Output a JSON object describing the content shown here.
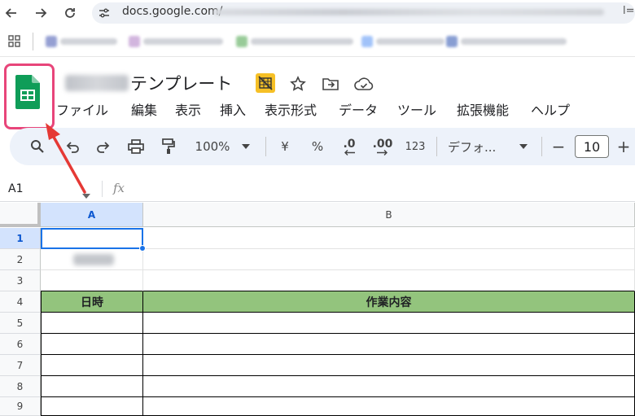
{
  "browser": {
    "url": "docs.google.com/",
    "url_tail": "l="
  },
  "doc": {
    "title": "テンプレート"
  },
  "menu": [
    "ファイル",
    "編集",
    "表示",
    "挿入",
    "表示形式",
    "データ",
    "ツール",
    "拡張機能",
    "ヘルプ"
  ],
  "toolbar": {
    "zoom": "100%",
    "currency": "¥",
    "percent": "%",
    "decrease_decimal": ".0",
    "increase_decimal": ".00",
    "number_format": "123",
    "font": "デフォ...",
    "font_size": "10",
    "minus": "−",
    "plus": "+"
  },
  "formula_bar": {
    "cell_ref": "A1",
    "fx": "fx"
  },
  "grid": {
    "columns": [
      "A",
      "B"
    ],
    "rows": [
      "1",
      "2",
      "3",
      "4",
      "5",
      "6",
      "7",
      "8",
      "9"
    ],
    "header_row": [
      "日時",
      "作業内容"
    ]
  },
  "colors": {
    "header_green": "#93c47d",
    "highlight": "#e8457a",
    "selection_blue": "#1a73e8",
    "arrow_red": "#e53935"
  }
}
